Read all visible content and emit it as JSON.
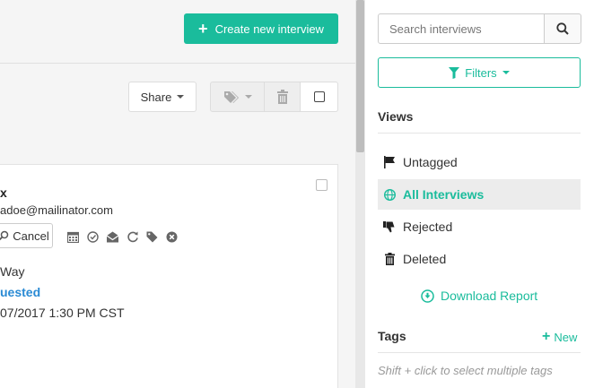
{
  "header": {
    "create_label": "Create new interview"
  },
  "toolbar": {
    "share_label": "Share"
  },
  "card": {
    "name": "x",
    "email": "adoe@mailinator.com",
    "cancel_label": "Cancel",
    "street": "Way",
    "status": "uested",
    "date": "07/2017 1:30 PM CST",
    "icons": [
      "calendar-icon",
      "clock-icon",
      "envelope-icon",
      "refresh-icon",
      "tag-icon",
      "close-circle-icon"
    ]
  },
  "sidebar": {
    "search_placeholder": "Search interviews",
    "filters_label": "Filters",
    "views_title": "Views",
    "views": [
      {
        "label": "Untagged",
        "icon": "flag-icon",
        "active": false
      },
      {
        "label": "All Interviews",
        "icon": "globe-icon",
        "active": true
      },
      {
        "label": "Rejected",
        "icon": "thumbs-down-icon",
        "active": false
      },
      {
        "label": "Deleted",
        "icon": "trash-icon",
        "active": false
      }
    ],
    "download_label": "Download Report",
    "tags_title": "Tags",
    "tags_new_label": "New",
    "tags_hint": "Shift + click to select multiple tags"
  },
  "colors": {
    "accent": "#1abc9c",
    "link_blue": "#2a8ad4"
  }
}
